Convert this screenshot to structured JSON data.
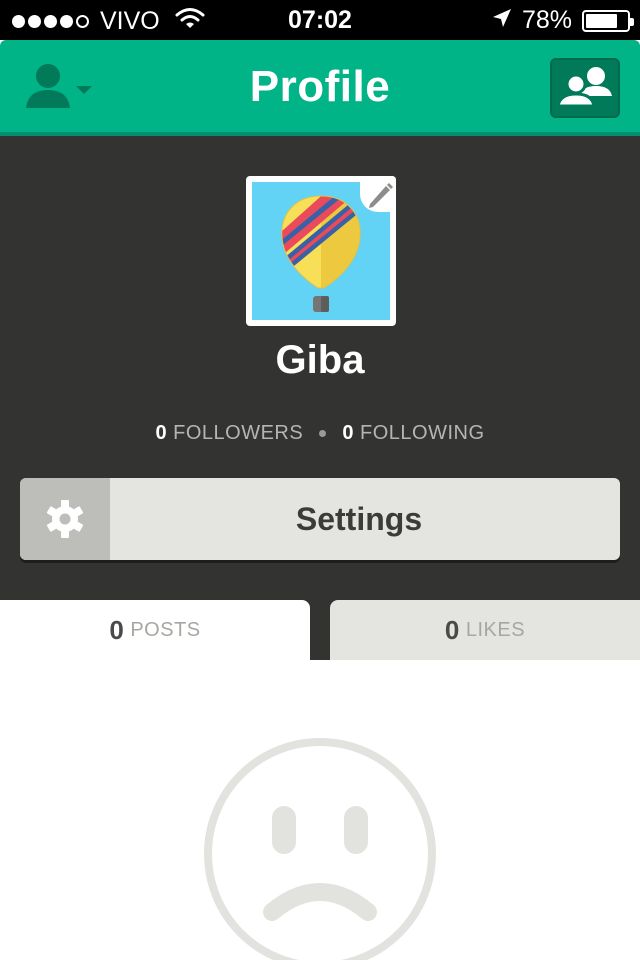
{
  "status_bar": {
    "carrier": "VIVO",
    "time": "07:02",
    "battery": "78%",
    "battery_level": 0.78,
    "signal_dots": 5,
    "signal_filled": 4,
    "icons": [
      "wifi-icon",
      "location-arrow-icon",
      "battery-icon"
    ]
  },
  "nav": {
    "title": "Profile",
    "left_icon": "user-dropdown-icon",
    "right_icon": "friends-icon"
  },
  "profile": {
    "username": "Giba",
    "avatar_icon": "hot-air-balloon-icon",
    "edit_icon": "pencil-icon",
    "followers_count": "0",
    "followers_label": "FOLLOWERS",
    "following_count": "0",
    "following_label": "FOLLOWING"
  },
  "settings": {
    "label": "Settings",
    "icon": "gear-icon"
  },
  "tabs": [
    {
      "count": "0",
      "label": "POSTS",
      "active": true
    },
    {
      "count": "0",
      "label": "LIKES",
      "active": false
    }
  ],
  "empty_state": {
    "icon": "sad-face-icon"
  },
  "colors": {
    "brand_green": "#00b488",
    "dark_header": "#333332",
    "tab_inactive": "#e4e4e1",
    "empty_icon": "#e2e2de"
  }
}
